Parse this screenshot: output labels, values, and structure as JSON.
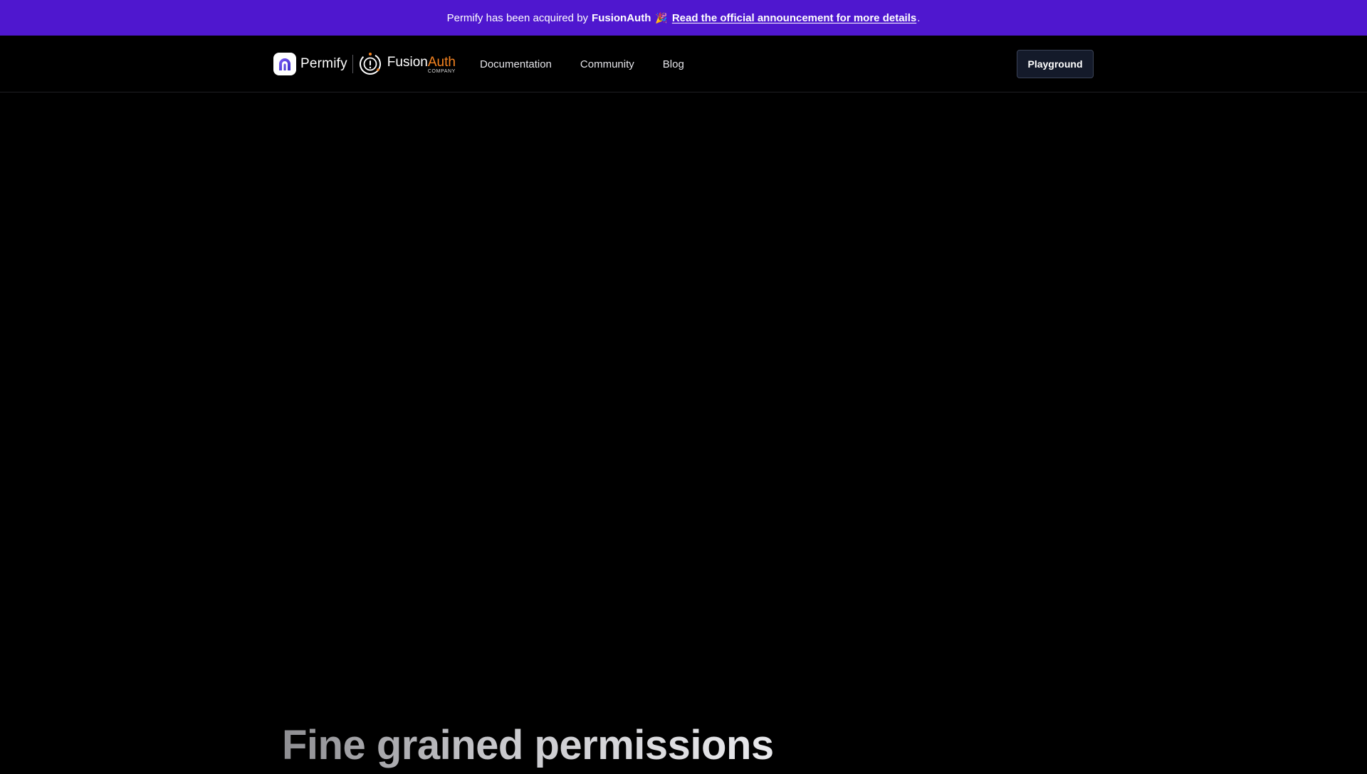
{
  "announcement": {
    "text_before": "Permify has been acquired by",
    "company": "FusionAuth",
    "emoji": "🎉",
    "link_text": "Read the official announcement for more details",
    "trailing": "."
  },
  "brand": {
    "permify_name": "Permify",
    "fusion": "Fusion",
    "auth": "Auth",
    "company_label": "COMPANY"
  },
  "nav": {
    "links": [
      "Documentation",
      "Community",
      "Blog"
    ],
    "cta_label": "Playground"
  },
  "hero": {
    "title": "Fine grained permissions"
  },
  "colors": {
    "banner": "#4f17cf",
    "background": "#000000",
    "fusionauth_orange": "#f58320",
    "button_bg": "#141a2a"
  }
}
